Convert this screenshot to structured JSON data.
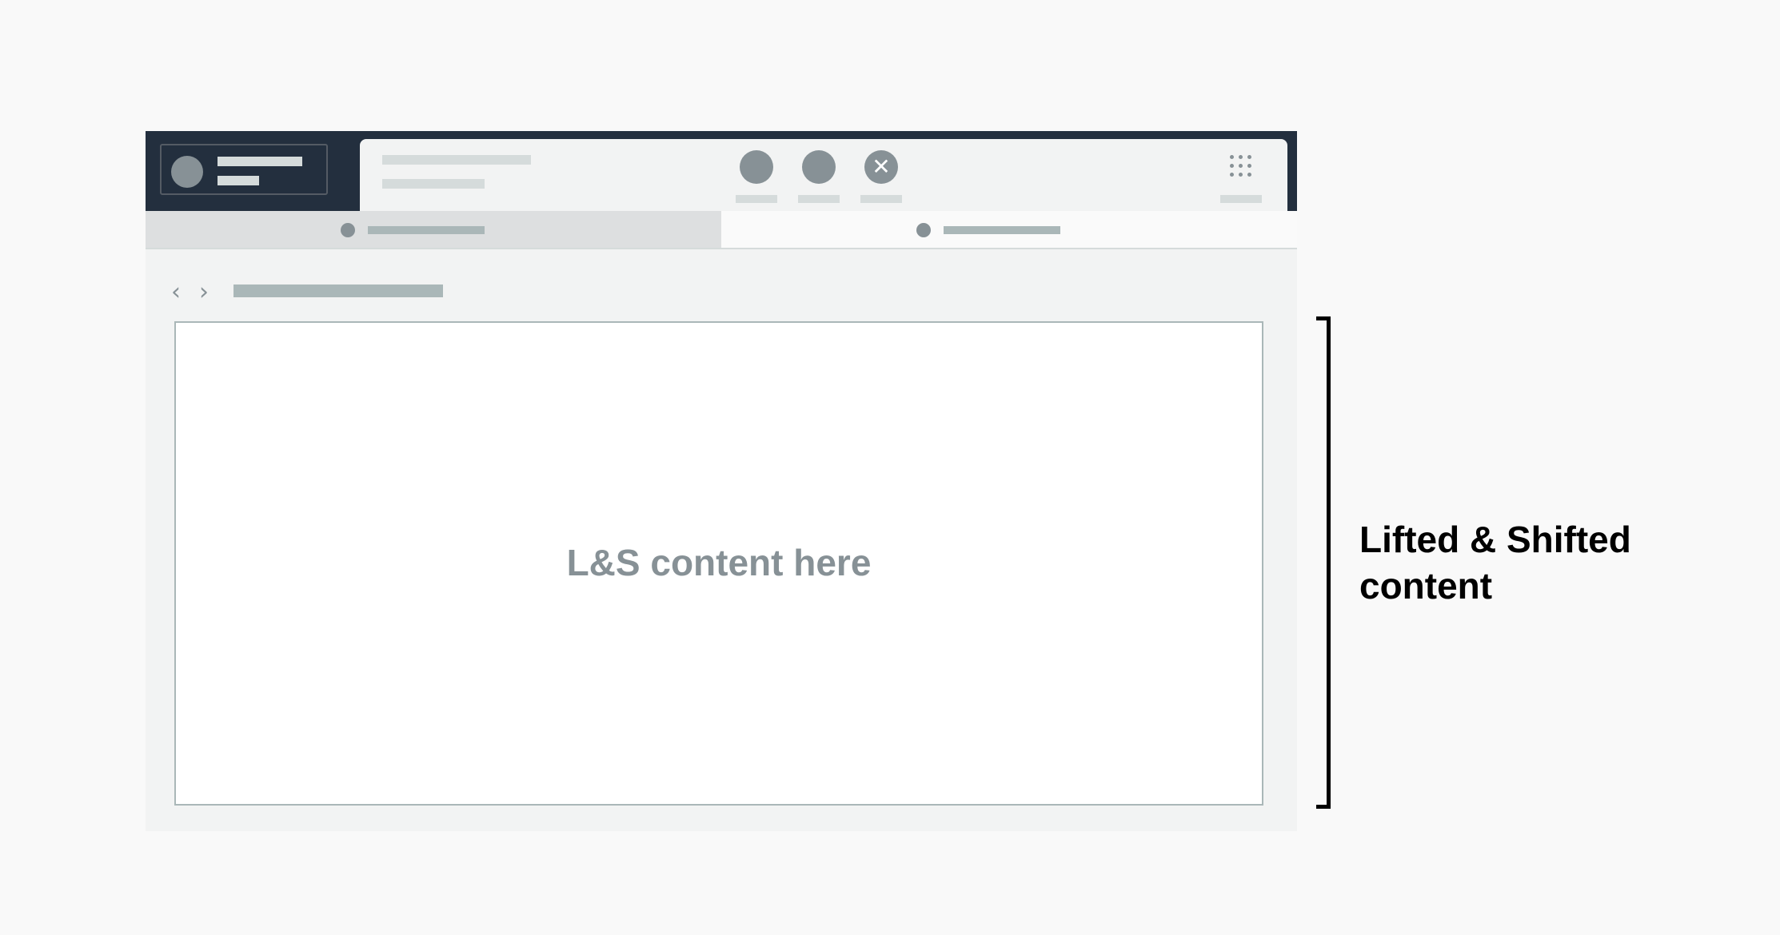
{
  "content_placeholder": "L&S content here",
  "annotation": {
    "line1": "Lifted & Shifted",
    "line2": "content"
  },
  "icons": {
    "close": "✕",
    "back": "‹",
    "forward": "›"
  },
  "colors": {
    "topbar": "#232f3e",
    "frame": "#f2f3f3",
    "placeholder_gray": "#879196"
  }
}
